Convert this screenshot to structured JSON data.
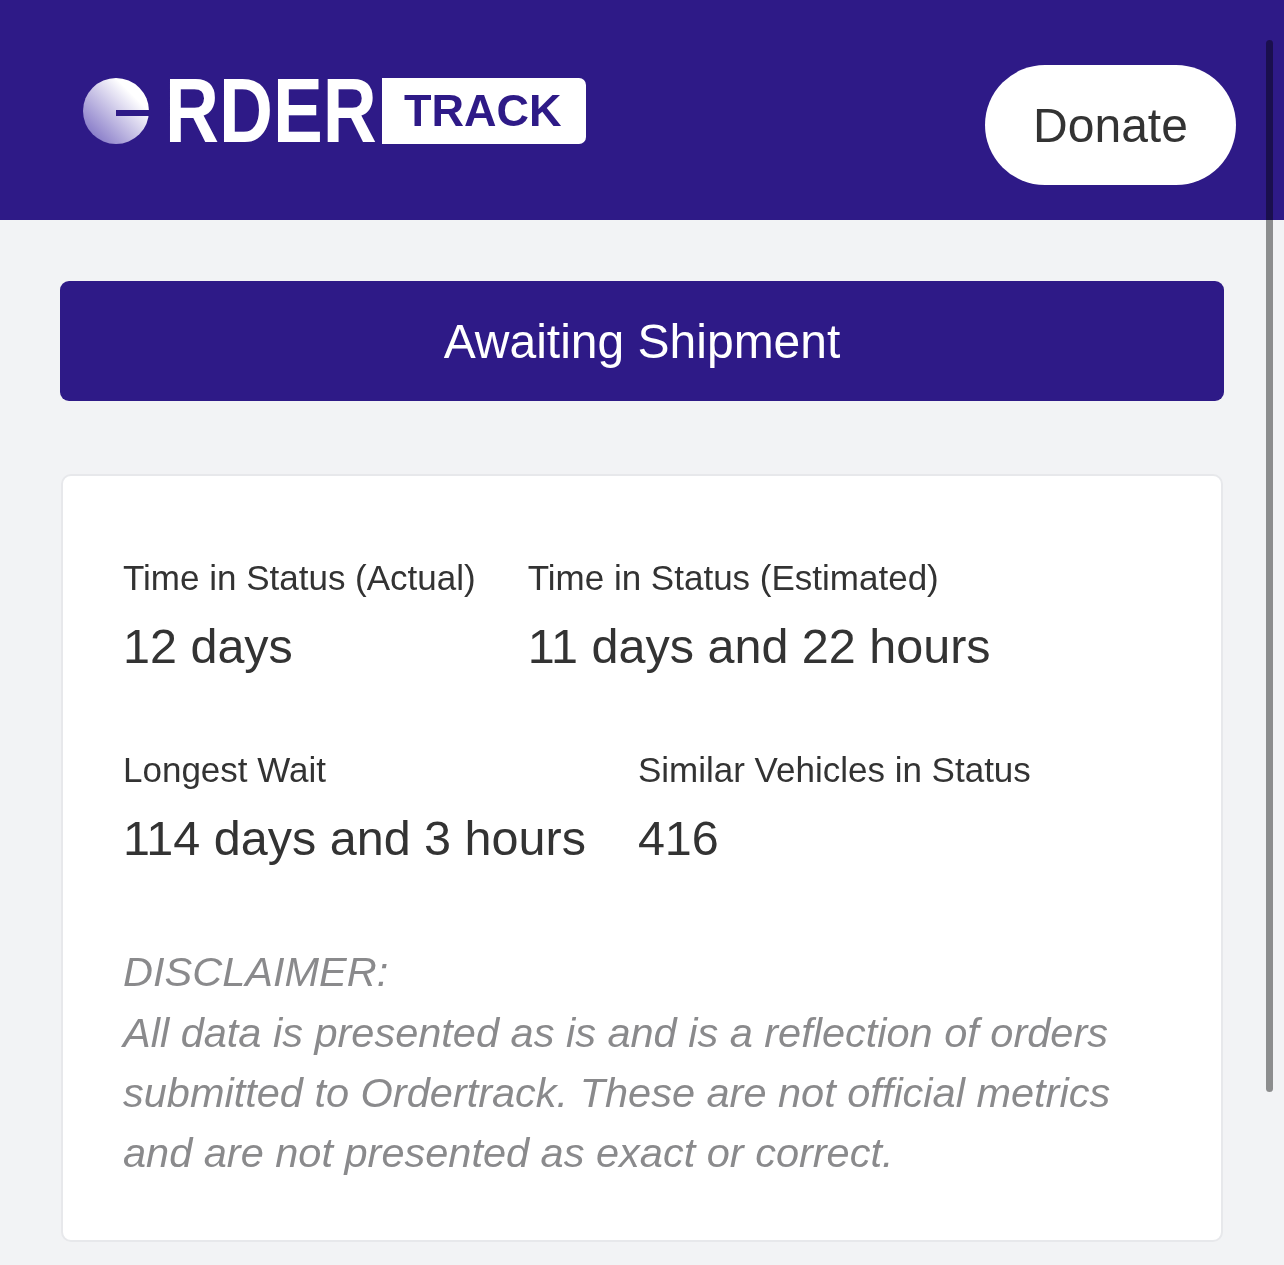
{
  "header": {
    "logo": {
      "wordmark": "RDER",
      "badge": "TRACK"
    },
    "donate_button": "Donate"
  },
  "status_banner": {
    "label": "Awaiting Shipment"
  },
  "stats_card": {
    "rows": [
      {
        "stats": [
          {
            "label": "Time in Status (Actual)",
            "value": "12 days"
          },
          {
            "label": "Time in Status (Estimated)",
            "value": "11 days and 22 hours"
          }
        ]
      },
      {
        "stats": [
          {
            "label": "Longest Wait",
            "value": "114 days and 3 hours"
          },
          {
            "label": "Similar Vehicles in Status",
            "value": "416"
          }
        ]
      }
    ]
  },
  "disclaimer": {
    "heading": "DISCLAIMER:",
    "text": "All data is presented as is and is a reflection of orders submitted to Ordertrack. These are not official metrics and are not presented as exact or correct."
  }
}
